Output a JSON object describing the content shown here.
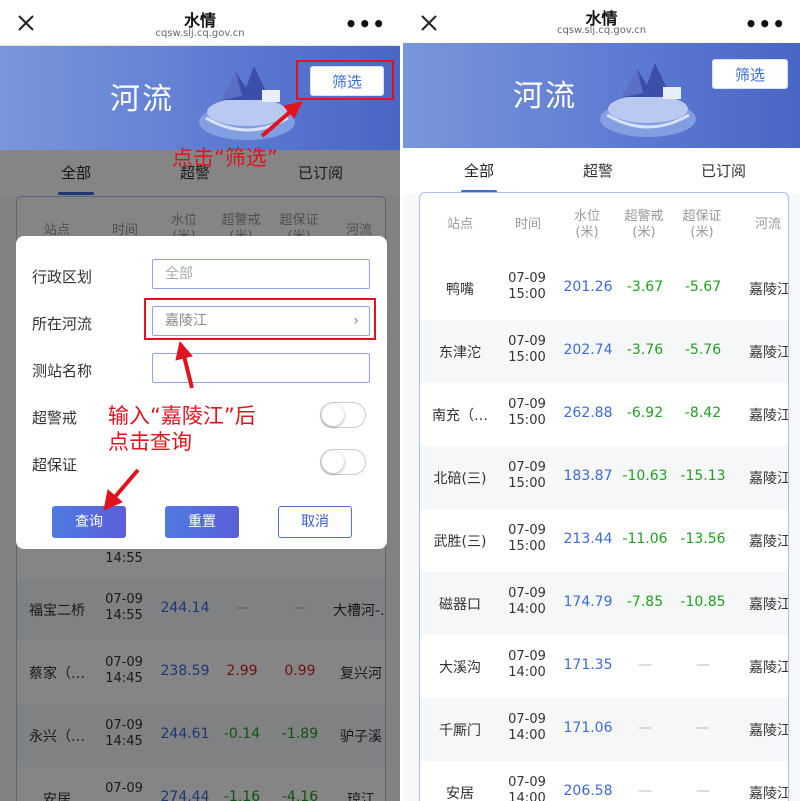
{
  "left": {
    "topbar": {
      "title": "水情",
      "url": "cqsw.slj.cq.gov.cn"
    },
    "banner": {
      "title": "河流",
      "filter_label": "筛选"
    },
    "tabs": [
      "全部",
      "超警",
      "已订阅"
    ],
    "columns": [
      "站点",
      "时间",
      "水位\n(米)",
      "超警戒\n(米)",
      "超保证\n(米)",
      "河流"
    ],
    "rows": [
      {
        "station": "福宝二桥",
        "date": "07-09",
        "time": "14:55",
        "level": "244.14",
        "warn": "—",
        "guar": "—",
        "river": "大槽河-…",
        "warn_color": "dash",
        "guar_color": "dash"
      },
      {
        "station": "蔡家（…",
        "date": "07-09",
        "time": "14:45",
        "level": "238.59",
        "warn": "2.99",
        "guar": "0.99",
        "river": "复兴河",
        "warn_color": "red",
        "guar_color": "red"
      },
      {
        "station": "永兴（…",
        "date": "07-09",
        "time": "14:45",
        "level": "244.61",
        "warn": "-0.14",
        "guar": "-1.89",
        "river": "驴子溪",
        "warn_color": "green",
        "guar_color": "green"
      },
      {
        "station": "安居",
        "date": "07-09",
        "time": "",
        "level": "274.44",
        "warn": "-1.16",
        "guar": "-4.16",
        "river": "琼江",
        "warn_color": "green",
        "guar_color": "green"
      }
    ],
    "partial_row_time": "14:55",
    "dialog": {
      "fields": [
        {
          "label": "行政区划",
          "value": "全部"
        },
        {
          "label": "所在河流",
          "value": "嘉陵江"
        },
        {
          "label": "测站名称",
          "value": ""
        }
      ],
      "toggles": [
        "超警戒",
        "超保证"
      ],
      "buttons": {
        "query": "查询",
        "reset": "重置",
        "cancel": "取消"
      }
    },
    "annotations": {
      "click_filter": "点击“筛选”",
      "enter_river_line1": "输入“嘉陵江”后",
      "enter_river_line2": "点击查询"
    }
  },
  "right": {
    "topbar": {
      "title": "水情",
      "url": "cqsw.slj.cq.gov.cn"
    },
    "banner": {
      "title": "河流",
      "filter_label": "筛选"
    },
    "tabs": [
      "全部",
      "超警",
      "已订阅"
    ],
    "columns": [
      "站点",
      "时间",
      "水位\n(米)",
      "超警戒\n(米)",
      "超保证\n(米)",
      "河流"
    ],
    "rows": [
      {
        "station": "鸭嘴",
        "date": "07-09",
        "time": "15:00",
        "level": "201.26",
        "warn": "-3.67",
        "guar": "-5.67",
        "river": "嘉陵江",
        "warn_color": "green",
        "guar_color": "green"
      },
      {
        "station": "东津沱",
        "date": "07-09",
        "time": "15:00",
        "level": "202.74",
        "warn": "-3.76",
        "guar": "-5.76",
        "river": "嘉陵江",
        "warn_color": "green",
        "guar_color": "green"
      },
      {
        "station": "南充（…",
        "date": "07-09",
        "time": "15:00",
        "level": "262.88",
        "warn": "-6.92",
        "guar": "-8.42",
        "river": "嘉陵江",
        "warn_color": "green",
        "guar_color": "green"
      },
      {
        "station": "北碚(三)",
        "date": "07-09",
        "time": "15:00",
        "level": "183.87",
        "warn": "-10.63",
        "guar": "-15.13",
        "river": "嘉陵江",
        "warn_color": "green",
        "guar_color": "green"
      },
      {
        "station": "武胜(三)",
        "date": "07-09",
        "time": "15:00",
        "level": "213.44",
        "warn": "-11.06",
        "guar": "-13.56",
        "river": "嘉陵江",
        "warn_color": "green",
        "guar_color": "green"
      },
      {
        "station": "磁器口",
        "date": "07-09",
        "time": "14:00",
        "level": "174.79",
        "warn": "-7.85",
        "guar": "-10.85",
        "river": "嘉陵江",
        "warn_color": "green",
        "guar_color": "green"
      },
      {
        "station": "大溪沟",
        "date": "07-09",
        "time": "14:00",
        "level": "171.35",
        "warn": "—",
        "guar": "—",
        "river": "嘉陵江",
        "warn_color": "dash",
        "guar_color": "dash"
      },
      {
        "station": "千厮门",
        "date": "07-09",
        "time": "14:00",
        "level": "171.06",
        "warn": "—",
        "guar": "—",
        "river": "嘉陵江",
        "warn_color": "dash",
        "guar_color": "dash"
      },
      {
        "station": "安居",
        "date": "07-09",
        "time": "14:00",
        "level": "206.58",
        "warn": "—",
        "guar": "—",
        "river": "嘉陵江",
        "warn_color": "dash",
        "guar_color": "dash"
      }
    ]
  },
  "colors": {
    "accent": "#3c6bd6",
    "annotation": "#e0141e",
    "positive": "#d02828",
    "negative": "#20a020"
  },
  "icons": [
    "close-icon",
    "more-icon",
    "chevron-right-icon",
    "arrow-icon"
  ]
}
